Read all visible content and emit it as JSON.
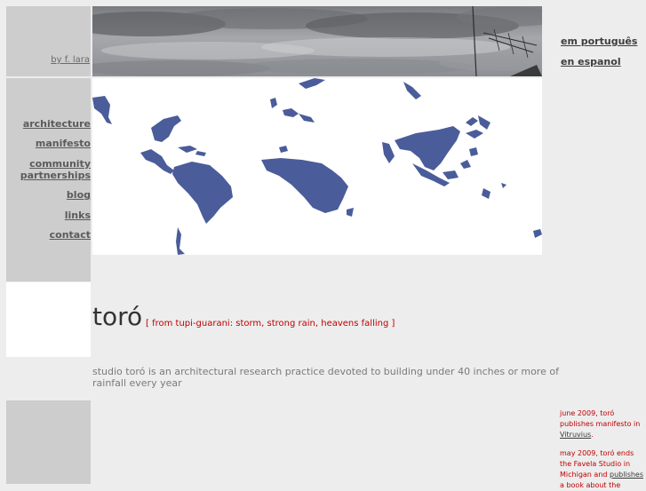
{
  "header": {
    "byline": "by f. lara"
  },
  "nav": {
    "architecture": "architecture",
    "manifesto": "manifesto",
    "community_partnerships": "community partnerships",
    "blog": "blog",
    "links": "links",
    "contact": "contact"
  },
  "languages": {
    "portuguese": "em português",
    "spanish": "en espanol"
  },
  "main": {
    "title": "toró",
    "subtitle": "[ from tupi-guarani: storm, strong rain, heavens falling ]",
    "description": "studio toró is an architectural research practice devoted to building under 40 inches or more of rainfall every year"
  },
  "news": {
    "item1_text": "june 2009, toró publishes manifesto in",
    "item1_link": "Vitruvius",
    "item1_end": ".",
    "item2_text": "may 2009, toró ends the Favela Studio in Michigan and",
    "item2_link": "publishes",
    "item2_more": "a book about the"
  },
  "colors": {
    "map_land": "#4a5c9a",
    "accent_red": "#c00000",
    "sidebar_gray": "#cdcdcd"
  }
}
